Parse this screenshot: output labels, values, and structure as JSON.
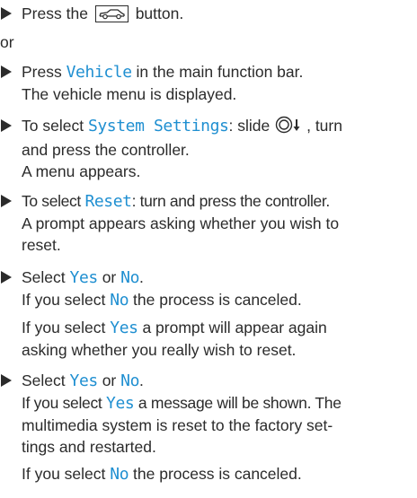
{
  "steps": {
    "s1": {
      "pre": "Press the",
      "post": "button."
    },
    "or": "or",
    "s2": {
      "pre": "Press",
      "hl": "Vehicle",
      "post": "in the main function bar.",
      "result": "The vehicle menu is displayed."
    },
    "s3": {
      "pre": "To select",
      "hl": "System Settings",
      "post": ": slide",
      "post2": ", turn",
      "line2": "and press the controller.",
      "result": "A menu appears."
    },
    "s4": {
      "pre": "To select",
      "hl": "Reset",
      "post": ": turn and press the controller.",
      "result1": "A prompt appears asking whether you wish to",
      "result2": "reset."
    },
    "s5": {
      "pre": "Select",
      "yes": "Yes",
      "or": "or",
      "no": "No",
      "end": ".",
      "r1_pre": "If you select",
      "r1_hl": "No",
      "r1_post": "the process is canceled.",
      "r2_pre": "If you select",
      "r2_hl": "Yes",
      "r2_post": "a prompt will appear again",
      "r2_line2": "asking whether you really wish to reset."
    },
    "s6": {
      "pre": "Select",
      "yes": "Yes",
      "or": "or",
      "no": "No",
      "end": ".",
      "r1_pre": "If you select",
      "r1_hl": "Yes",
      "r1_post": "a message will be shown. The",
      "r1_line2": "multimedia system is reset to the factory set-",
      "r1_line3": "tings and restarted.",
      "r2_pre": "If you select",
      "r2_hl": "No",
      "r2_post": "the process is canceled."
    }
  },
  "icons": {
    "vehicle_button": "car-icon",
    "controller": "controller-slide-down-icon"
  },
  "colors": {
    "highlight": "#1f8fd1",
    "text": "#2b2b2b"
  }
}
